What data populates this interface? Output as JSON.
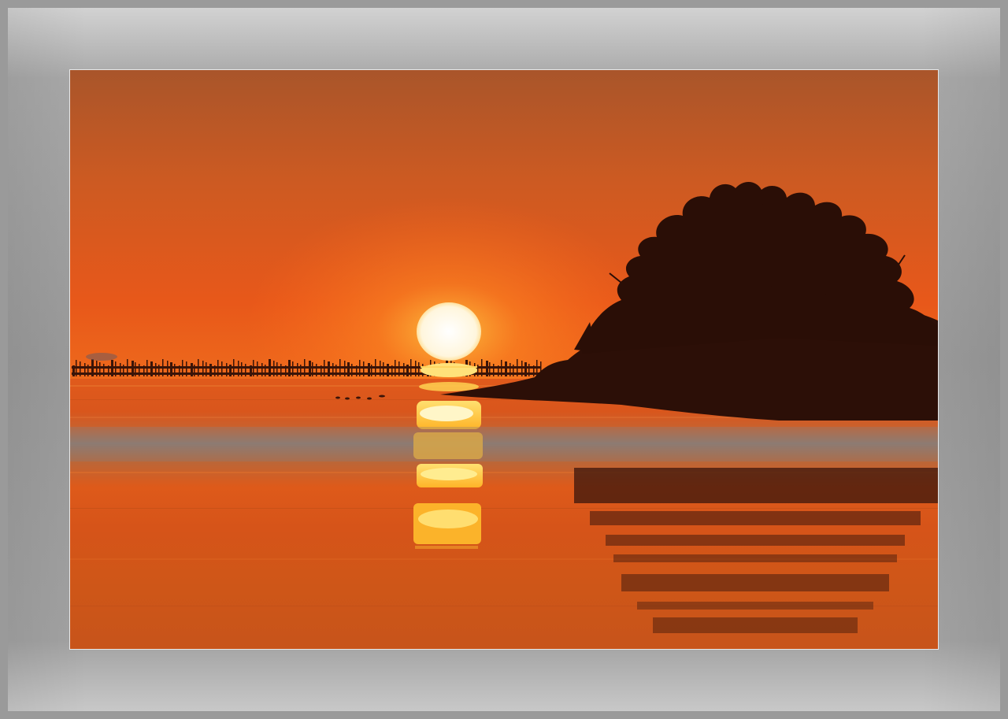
{
  "image": {
    "subject": "sunset-over-calm-sea-with-tree-covered-islet",
    "colors": {
      "frame": "#9a9a9a",
      "sky_top": "#a9552a",
      "sky_mid": "#e4531a",
      "sky_horizon": "#f0661a",
      "sun": "#fff8e8",
      "sun_glow": "#ffb63c",
      "water": "#d9571c",
      "water_band": "#8b7c74",
      "silhouette": "#2a0f08"
    }
  }
}
